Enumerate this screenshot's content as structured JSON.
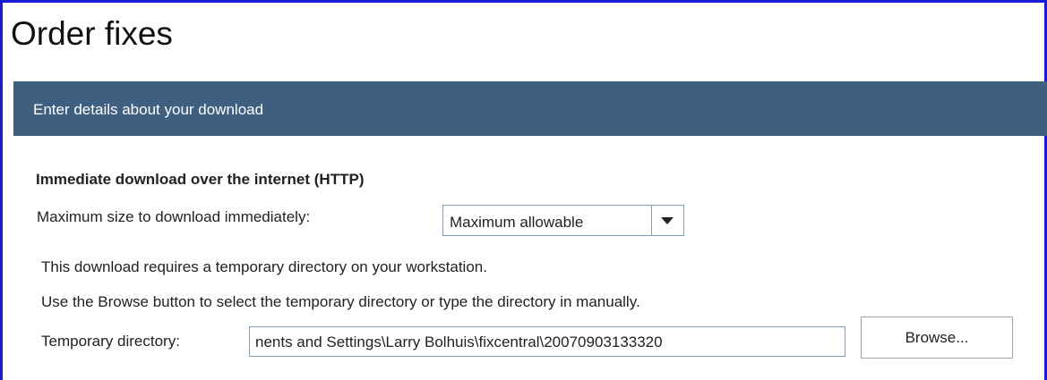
{
  "page": {
    "title": "Order fixes"
  },
  "banner": {
    "text": "Enter details about your download"
  },
  "section": {
    "heading": "Immediate download over the internet (HTTP)",
    "max_size_label": "Maximum size to download immediately:",
    "max_size_selected": "Maximum allowable",
    "info_line1": "This download requires a temporary directory on your workstation.",
    "info_line2": "Use the Browse button to select the temporary directory or type the directory in manually.",
    "temp_dir_label": "Temporary directory:",
    "temp_dir_value": "nents and Settings\\Larry Bolhuis\\fixcentral\\20070903133320",
    "browse_label": "Browse..."
  },
  "colors": {
    "frame_border": "#1a1ad6",
    "banner_bg": "#3e5f80",
    "input_border": "#7f9db9"
  },
  "icons": {
    "dropdown": "chevron-down-icon"
  }
}
